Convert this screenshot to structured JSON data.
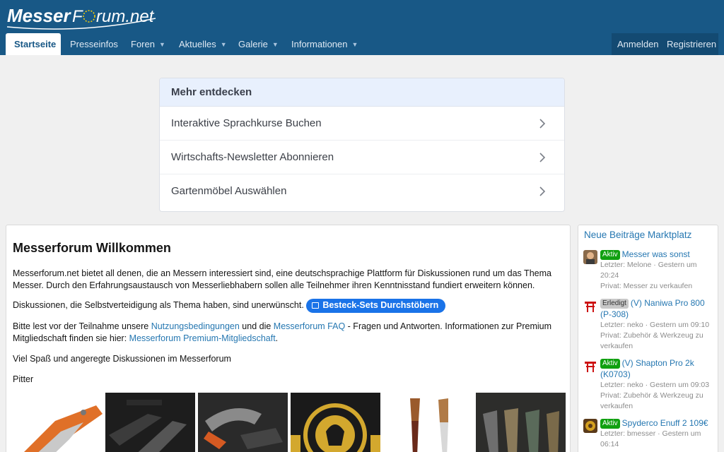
{
  "brand": {
    "logo_text": "MesserForum.net"
  },
  "nav": {
    "tabs": [
      {
        "label": "Startseite"
      },
      {
        "label": "Presseinfos"
      },
      {
        "label": "Foren"
      },
      {
        "label": "Aktuelles"
      },
      {
        "label": "Galerie"
      },
      {
        "label": "Informationen"
      }
    ],
    "login": "Anmelden",
    "register": "Registrieren"
  },
  "discover": {
    "title": "Mehr entdecken",
    "items": [
      {
        "label": "Interaktive Sprachkurse Buchen"
      },
      {
        "label": "Wirtschafts-Newsletter Abonnieren"
      },
      {
        "label": "Gartenmöbel Auswählen"
      }
    ]
  },
  "welcome": {
    "title": "Messerforum Willkommen",
    "p1": "Messerforum.net bietet all denen, die an Messern interessiert sind, eine deutschsprachige Plattform für Diskussionen rund um das Thema Messer. Durch den Erfahrungsaustausch von Messerliebhabern sollen alle Teilnehmer ihren Kenntnisstand fundiert erweitern können.",
    "p2": "Diskussionen, die Selbstverteidigung als Thema haben, sind unerwünscht.",
    "cta": "Besteck-Sets Durchstöbern",
    "p3_a": "Bitte lest vor der Teilnahme unsere ",
    "p3_link1": "Nutzungsbedingungen",
    "p3_b": " und die ",
    "p3_link2": "Messerforum FAQ",
    "p3_c": " - Fragen und Antworten. Informationen zur Premium Mitgliedschaft finden sie hier: ",
    "p3_link3": "Messerforum Premium-Mitgliedschaft",
    "p3_d": ".",
    "p4": "Viel Spaß und angeregte Diskussionen im Messerforum",
    "signature": "Pitter"
  },
  "sidebar": {
    "title": "Neue Beiträge Marktplatz",
    "items": [
      {
        "badge": "Aktiv",
        "title": "Messer was sonst",
        "meta1": "Letzter: Melone · Gestern um 20:24",
        "meta2": "Privat: Messer zu verkaufen"
      },
      {
        "badge": "Erledigt",
        "title": "(V) Naniwa Pro 800 (P-308)",
        "meta1": "Letzter: neko · Gestern um 09:10",
        "meta2": "Privat: Zubehör & Werkzeug zu verkaufen"
      },
      {
        "badge": "Aktiv",
        "title": "(V) Shapton Pro 2k (K0703)",
        "meta1": "Letzter: neko · Gestern um 09:03",
        "meta2": "Privat: Zubehör & Werkzeug zu verkaufen"
      },
      {
        "badge": "Aktiv",
        "title": "Spyderco Enuff 2 109€",
        "meta1": "Letzter: bmesser · Gestern um 06:14",
        "meta2": ""
      }
    ]
  },
  "colors": {
    "header": "#185886",
    "link": "#2577b1",
    "badge_active": "#10a010",
    "cta": "#1a73e8"
  }
}
